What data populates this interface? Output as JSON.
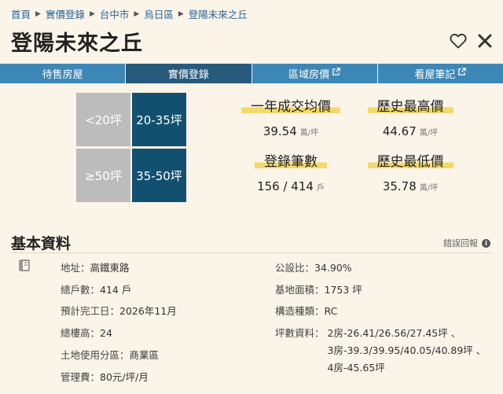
{
  "breadcrumb": [
    "首頁",
    "實價登錄",
    "台中市",
    "烏日區",
    "登陽未來之丘"
  ],
  "title": "登陽未來之丘",
  "icons": {
    "favorite": "heart-outline-icon",
    "close": "close-icon",
    "external": "external-link-icon",
    "book": "book-icon",
    "info": "info-icon"
  },
  "tabs": [
    {
      "label": "待售房屋",
      "active": false,
      "external": false
    },
    {
      "label": "實價登錄",
      "active": true,
      "external": false
    },
    {
      "label": "區域房價",
      "active": false,
      "external": true
    },
    {
      "label": "看屋筆記",
      "active": false,
      "external": true
    }
  ],
  "size_filters": [
    {
      "label": "<20坪",
      "active": false
    },
    {
      "label": "20-35坪",
      "active": true
    },
    {
      "label": "≥50坪",
      "active": false
    },
    {
      "label": "35-50坪",
      "active": true
    }
  ],
  "stats": [
    {
      "label": "一年成交均價",
      "value": "39.54",
      "unit": "萬/坪"
    },
    {
      "label": "歷史最高價",
      "value": "44.67",
      "unit": "萬/坪"
    },
    {
      "label": "登錄筆數",
      "value": "156 / 414",
      "unit": "戶"
    },
    {
      "label": "歷史最低價",
      "value": "35.78",
      "unit": "萬/坪"
    }
  ],
  "basic_info": {
    "title": "基本資料",
    "report_label": "錯誤回報",
    "left": [
      {
        "key": "地址：",
        "value": "高鐵東路"
      },
      {
        "key": "總戶數：",
        "value": "414 戶"
      },
      {
        "key": "預計完工日：",
        "value": "2026年11月"
      },
      {
        "key": "總樓高：",
        "value": "24"
      },
      {
        "key": "土地使用分區：",
        "value": "商業區"
      },
      {
        "key": "管理費：",
        "value": "80元/坪/月"
      }
    ],
    "right": [
      {
        "key": "公設比：",
        "value": "34.90%"
      },
      {
        "key": "基地面積：",
        "value": "1753 坪"
      },
      {
        "key": "構造種類：",
        "value": "RC"
      }
    ],
    "sizes_key": "坪數資料：",
    "sizes": [
      "2房-26.41/26.56/27.45坪 、",
      "3房-39.3/39.95/40.05/40.89坪 、",
      "4房-45.65坪"
    ]
  },
  "colors": {
    "background": "#fbf4e8",
    "tab_bar": "#3d87b6",
    "tab_active": "#285a7c",
    "filter_active": "#12506f",
    "filter_inactive": "#bcbcbc",
    "highlight": "#f3d96a",
    "link": "#2a6496"
  }
}
